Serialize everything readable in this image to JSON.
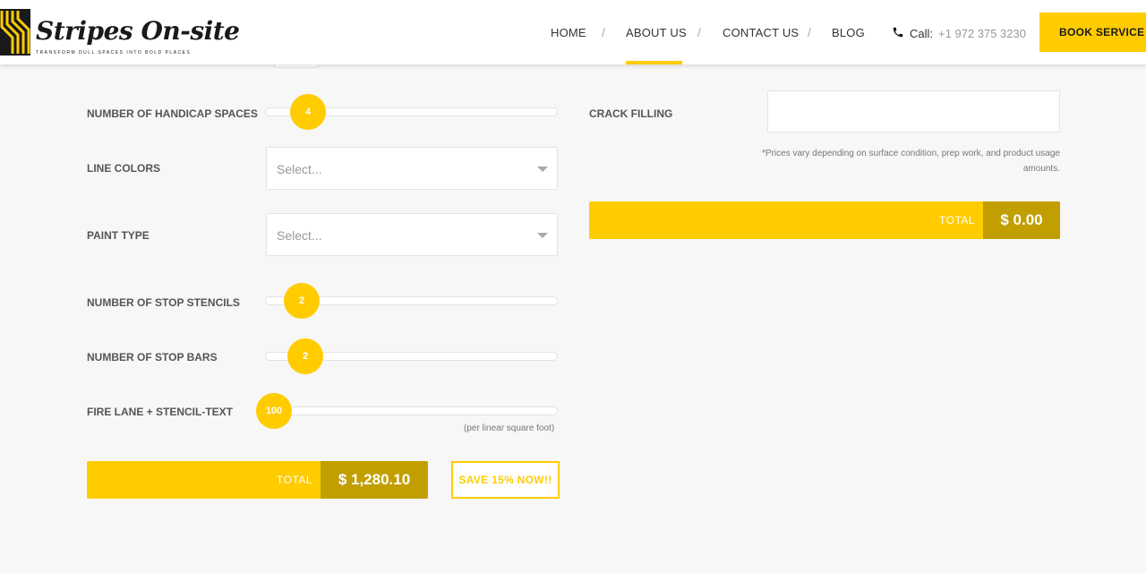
{
  "brand": {
    "name": "Stripes On-site",
    "tagline": "TRANSFORM DULL SPACES INTO BOLD PLACES"
  },
  "nav": {
    "items": [
      "HOME",
      "ABOUT US",
      "CONTACT US",
      "BLOG"
    ],
    "active": "ABOUT US",
    "separator": "/",
    "phone_label": "Call:",
    "phone_number": "+1 972 375 3230",
    "book_label": "BOOK SERVICE"
  },
  "form": {
    "handicap": {
      "label": "NUMBER OF HANDICAP SPACES",
      "value": "4"
    },
    "line_colors": {
      "label": "LINE COLORS",
      "placeholder": "Select..."
    },
    "paint_type": {
      "label": "PAINT TYPE",
      "placeholder": "Select..."
    },
    "stop_stencils": {
      "label": "NUMBER OF STOP STENCILS",
      "value": "2"
    },
    "stop_bars": {
      "label": "NUMBER OF STOP BARS",
      "value": "2"
    },
    "fire_lane": {
      "label": "FIRE LANE + STENCIL-TEXT",
      "value": "100",
      "unit_note": "(per linear square foot)"
    },
    "total": {
      "label": "TOTAL",
      "value": "$ 1,280.10"
    },
    "save_label": "SAVE 15% NOW!!"
  },
  "side": {
    "crack_filling_label": "CRACK FILLING",
    "crack_filling_value": "",
    "disclaimer": "*Prices vary depending on surface condition, prep work, and product usage amounts.",
    "total": {
      "label": "TOTAL",
      "value": "$ 0.00"
    }
  },
  "colors": {
    "accent": "#ffcc00",
    "accent_dark": "#c29f00",
    "background": "#f7f7f7"
  }
}
